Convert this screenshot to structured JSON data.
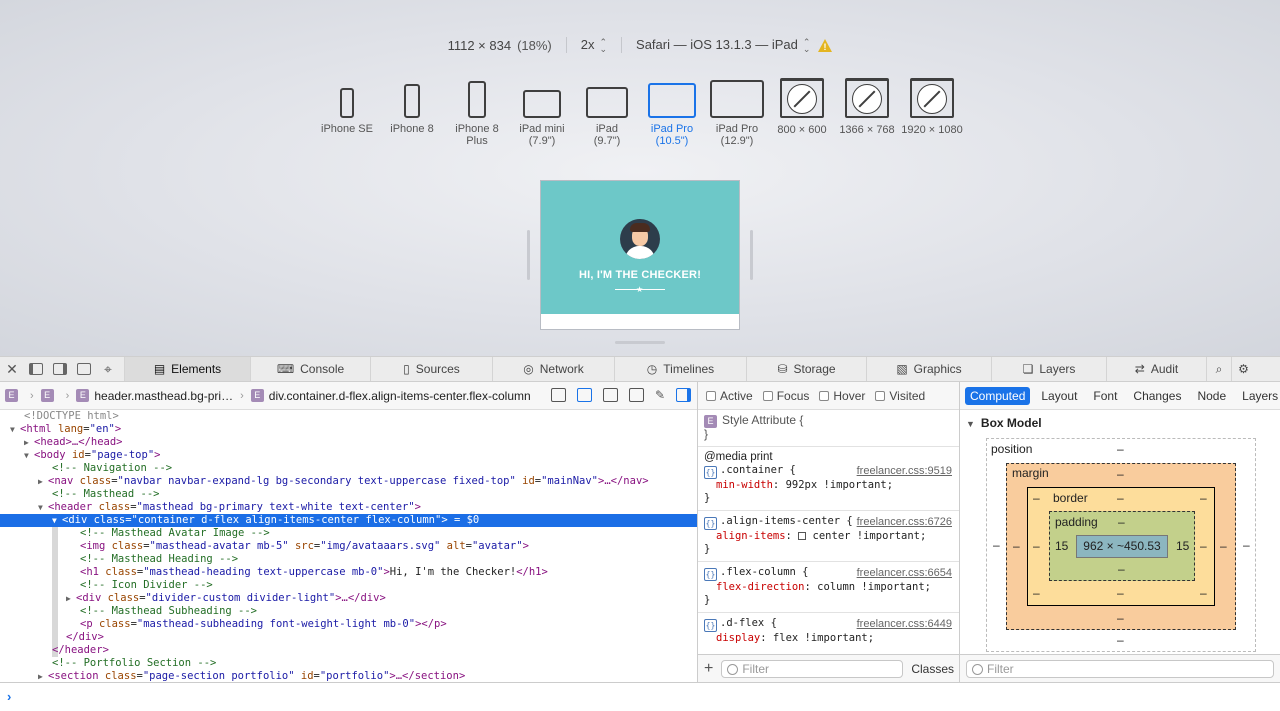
{
  "rdm": {
    "dimensions": "1112 × 834",
    "zoom_pct": "(18%)",
    "scale": "2x",
    "ua": "Safari — iOS 13.1.3 — iPad",
    "devices": [
      {
        "label": "iPhone SE",
        "icon": "phone-icon"
      },
      {
        "label": "iPhone 8",
        "icon": "phone-icon"
      },
      {
        "label": "iPhone 8 Plus",
        "icon": "phone-icon"
      },
      {
        "label": "iPad mini (7.9\")",
        "icon": "tablet-icon"
      },
      {
        "label": "iPad (9.7\")",
        "icon": "tablet-icon"
      },
      {
        "label": "iPad Pro (10.5\")",
        "icon": "tablet-icon"
      },
      {
        "label": "iPad Pro (12.9\")",
        "icon": "tablet-icon"
      },
      {
        "label": "800 × 600",
        "icon": "safari-compass-icon"
      },
      {
        "label": "1366 × 768",
        "icon": "safari-compass-icon"
      },
      {
        "label": "1920 × 1080",
        "icon": "safari-compass-icon"
      }
    ],
    "device_labels": {
      "d0": "iPhone SE",
      "d1": "iPhone 8",
      "d2a": "iPhone 8",
      "d2b": "Plus",
      "d3a": "iPad mini",
      "d3b": "(7.9\")",
      "d4a": "iPad",
      "d4b": "(9.7\")",
      "d5a": "iPad Pro",
      "d5b": "(10.5\")",
      "d6a": "iPad Pro",
      "d6b": "(12.9\")",
      "d7": "800 × 600",
      "d8": "1366 × 768",
      "d9": "1920 × 1080"
    },
    "preview_heading": "HI, I'M THE CHECKER!",
    "colors": {
      "accent": "#1a73e8",
      "preview_teal": "#6dc8c8"
    }
  },
  "tabs": [
    "Elements",
    "Console",
    "Sources",
    "Network",
    "Timelines",
    "Storage",
    "Graphics",
    "Layers",
    "Audit"
  ],
  "breadcrumb": {
    "item1": "header.masthead.bg-pri…",
    "item2": "div.container.d-flex.align-items-center.flex-column"
  },
  "dom": {
    "l0": "<!DOCTYPE html>",
    "l1_tag": "<html ",
    "l1_an": "lang",
    "l1_av": "\"en\"",
    "l1_end": ">",
    "l2_tag": "<head>…</head>",
    "l3_tag": "<body ",
    "l3_an": "id",
    "l3_av": "\"page-top\"",
    "l3_end": ">",
    "l4": "<!-- Navigation -->",
    "l5_tag": "<nav ",
    "l5_an": "class",
    "l5_av": "\"navbar navbar-expand-lg bg-secondary text-uppercase fixed-top\"",
    "l5_an2": " id",
    "l5_av2": "\"mainNav\"",
    "l5_end": ">…</nav>",
    "l6": "<!-- Masthead -->",
    "l7_tag": "<header ",
    "l7_an": "class",
    "l7_av": "\"masthead bg-primary text-white text-center\"",
    "l7_end": ">",
    "l8_tag": "<div ",
    "l8_an": "class",
    "l8_av": "\"container d-flex align-items-center flex-column\"",
    "l8_end": "> = $0",
    "l9": "<!-- Masthead Avatar Image -->",
    "l10_tag": "<img ",
    "l10_an": "class",
    "l10_av": "\"masthead-avatar mb-5\"",
    "l10_an2": " src",
    "l10_av2": "\"img/avataaars.svg\"",
    "l10_an3": " alt",
    "l10_av3": "\"avatar\"",
    "l10_end": ">",
    "l11": "<!-- Masthead Heading -->",
    "l12_tag": "<h1 ",
    "l12_an": "class",
    "l12_av": "\"masthead-heading text-uppercase mb-0\"",
    "l12_end": ">",
    "l12_text": "Hi, I'm the Checker!",
    "l12_close": "</h1>",
    "l13": "<!-- Icon Divider -->",
    "l14_tag": "<div ",
    "l14_an": "class",
    "l14_av": "\"divider-custom divider-light\"",
    "l14_end": ">…</div>",
    "l15": "<!-- Masthead Subheading -->",
    "l16_tag": "<p ",
    "l16_an": "class",
    "l16_av": "\"masthead-subheading font-weight-light mb-0\"",
    "l16_end": "></p>",
    "l17": "</div>",
    "l18": "</header>",
    "l19": "<!-- Portfolio Section -->",
    "l20_tag": "<section ",
    "l20_an": "class",
    "l20_av": "\"page-section portfolio\"",
    "l20_an2": " id",
    "l20_av2": "\"portfolio\"",
    "l20_end": ">…</section>"
  },
  "styles": {
    "pseudo": [
      "Active",
      "Focus",
      "Hover",
      "Visited"
    ],
    "style_attr": "Style Attribute",
    "media": "@media print",
    "rules": [
      {
        "selector": ".container",
        "source": "freelancer.css:9519",
        "prop": "min-width",
        "value": "992px !important"
      },
      {
        "selector": ".align-items-center",
        "source": "freelancer.css:6726",
        "prop": "align-items",
        "value": "center !important"
      },
      {
        "selector": ".flex-column",
        "source": "freelancer.css:6654",
        "prop": "flex-direction",
        "value": "column !important"
      },
      {
        "selector": ".d-flex",
        "source": "freelancer.css:6449",
        "prop": "display",
        "value": "flex !important"
      }
    ],
    "filter_placeholder": "Filter",
    "classes_label": "Classes"
  },
  "computed": {
    "tabs": [
      "Computed",
      "Layout",
      "Font",
      "Changes",
      "Node",
      "Layers"
    ],
    "box_model_title": "Box Model",
    "position_label": "position",
    "margin_label": "margin",
    "border_label": "border",
    "padding_label": "padding",
    "dash": "–",
    "pad_left": "15",
    "pad_right": "15",
    "content_size": "962 × ~450.53",
    "filter_placeholder": "Filter"
  },
  "console": {
    "prompt": "›"
  }
}
